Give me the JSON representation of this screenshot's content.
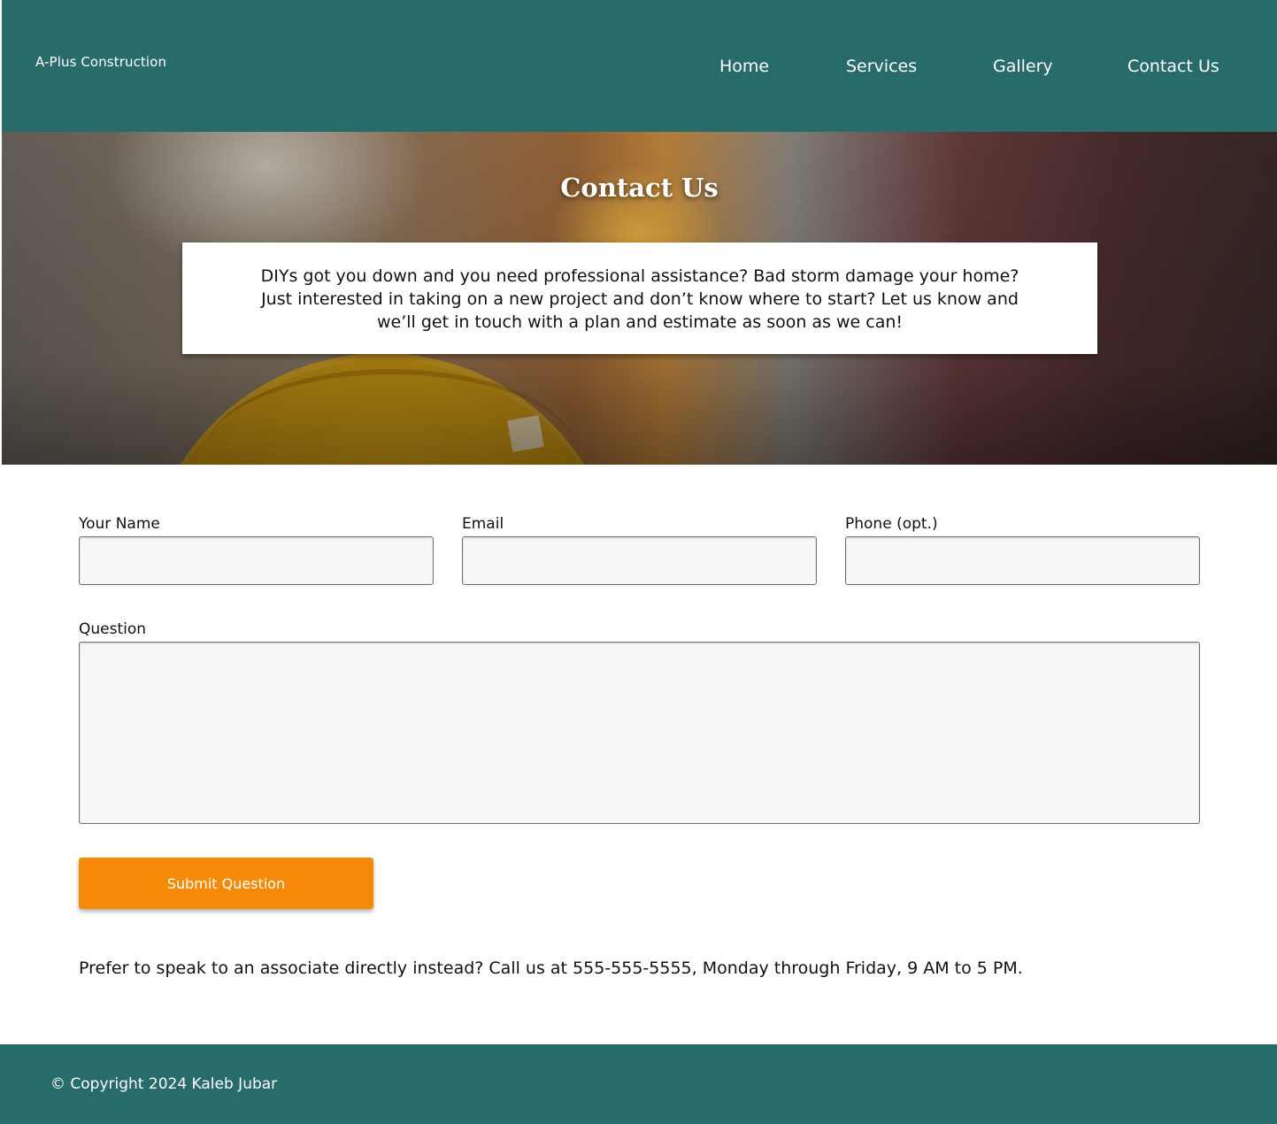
{
  "header": {
    "brand": "A-Plus Construction",
    "nav": [
      {
        "label": "Home"
      },
      {
        "label": "Services"
      },
      {
        "label": "Gallery"
      },
      {
        "label": "Contact Us"
      }
    ]
  },
  "hero": {
    "title": "Contact Us",
    "description": "DIYs got you down and you need professional assistance? Bad storm damage your home? Just interested in taking on a new project and don’t know where to start? Let us know and we’ll get in touch with a plan and estimate as soon as we can!"
  },
  "form": {
    "name_label": "Your Name",
    "name_value": "",
    "email_label": "Email",
    "email_value": "",
    "phone_label": "Phone (opt.)",
    "phone_value": "",
    "question_label": "Question",
    "question_value": "",
    "submit_label": "Submit Question"
  },
  "call_note": "Prefer to speak to an associate directly instead? Call us at 555-555-5555, Monday through Friday, 9 AM to 5 PM.",
  "footer": {
    "copyright": "© Copyright 2024 Kaleb Jubar"
  },
  "colors": {
    "header_bg": "#276b6a",
    "accent": "#f58a07",
    "input_bg": "#f7f7f7"
  }
}
